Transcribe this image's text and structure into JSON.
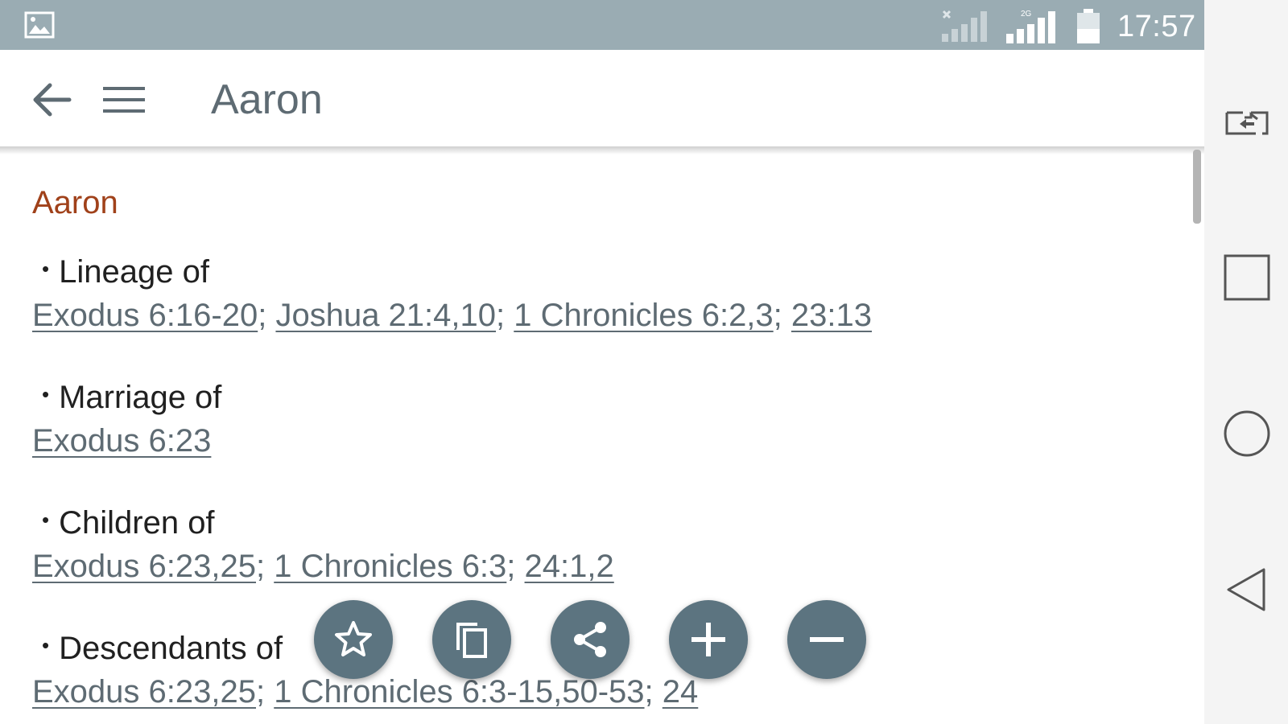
{
  "status_bar": {
    "time": "17:57",
    "icons": [
      "gallery-icon",
      "signal-disabled-icon",
      "signal-2g-icon",
      "battery-icon"
    ]
  },
  "app_bar": {
    "title": "Aaron",
    "icons": [
      "back-arrow-icon",
      "hamburger-menu-icon"
    ]
  },
  "entry": {
    "title": "Aaron",
    "sections": [
      {
        "heading": "Lineage of",
        "refs": [
          "Exodus 6:16-20",
          "Joshua 21:4,10",
          "1 Chronicles 6:2,3",
          "23:13"
        ]
      },
      {
        "heading": "Marriage of",
        "refs": [
          "Exodus 6:23"
        ]
      },
      {
        "heading": "Children of",
        "refs": [
          "Exodus 6:23,25",
          "1 Chronicles 6:3",
          "24:1,2"
        ]
      },
      {
        "heading": "Descendants of",
        "refs": [
          "Exodus 6:23,25",
          "1 Chronicles 6:3-15,50-53",
          "24"
        ]
      }
    ],
    "bullet": "•",
    "separator": ";"
  },
  "fabs": [
    "star-icon",
    "copy-icon",
    "share-icon",
    "plus-icon",
    "minus-icon"
  ],
  "nav_bar": [
    "dual-window-icon",
    "recents-square-icon",
    "home-circle-icon",
    "back-triangle-icon"
  ],
  "colors": {
    "status_bar": "#9aacb3",
    "accent_title": "#a0411a",
    "fab": "#5c7480",
    "link": "#5e6b73"
  }
}
